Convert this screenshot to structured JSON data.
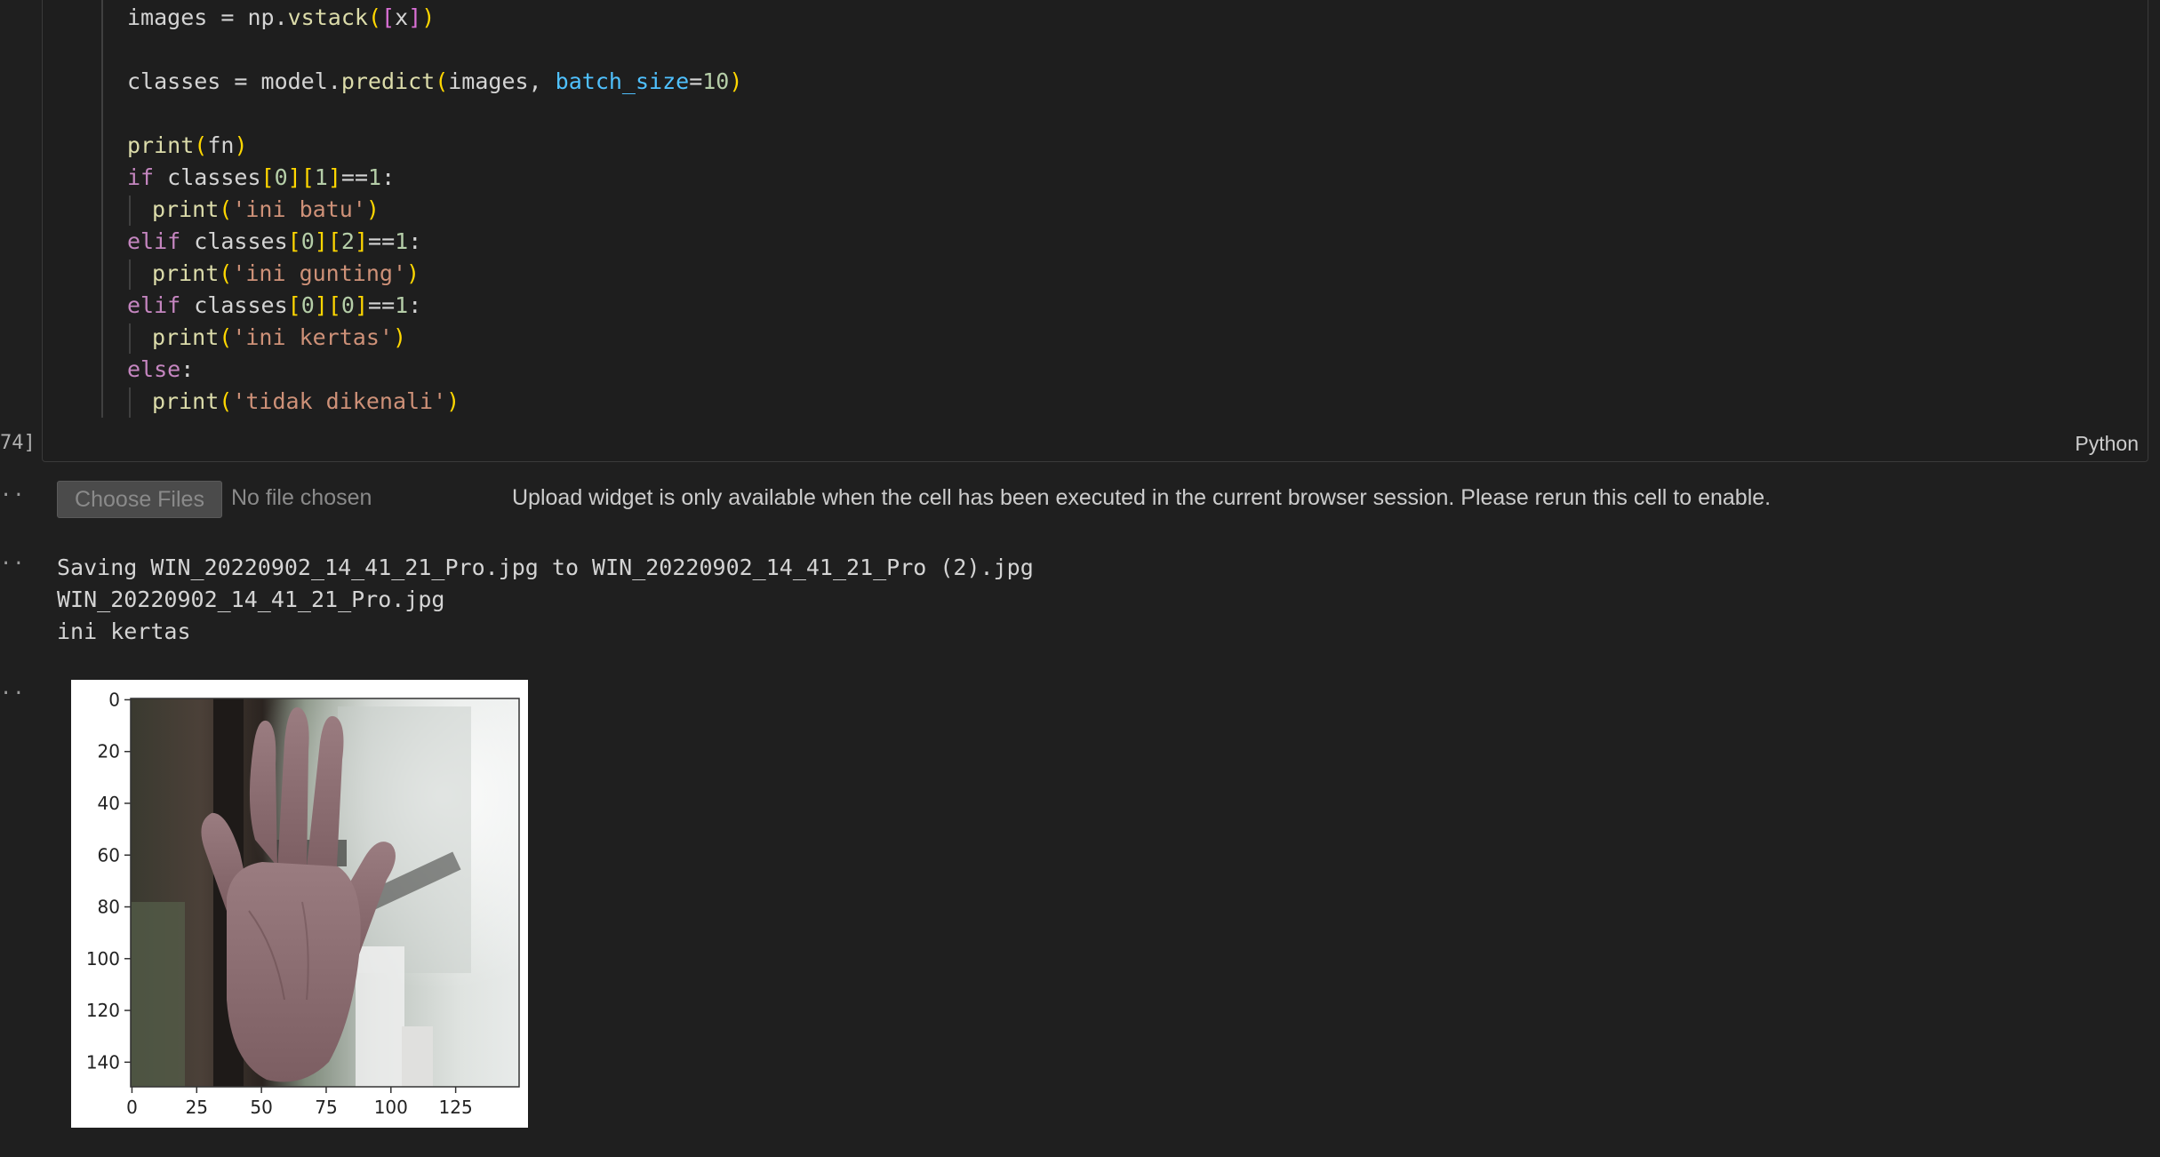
{
  "cell": {
    "code_lines": [
      {
        "indent": false,
        "tokens": [
          [
            "images = np.",
            ""
          ],
          [
            "vstack",
            "fn"
          ],
          [
            "(",
            "b1"
          ],
          [
            "[",
            "b2"
          ],
          [
            "x",
            ""
          ],
          [
            "]",
            "b2"
          ],
          [
            ")",
            "b1"
          ]
        ]
      },
      {
        "indent": false,
        "tokens": []
      },
      {
        "indent": false,
        "tokens": [
          [
            "classes = model.",
            ""
          ],
          [
            "predict",
            "fn"
          ],
          [
            "(",
            "b1"
          ],
          [
            "images, ",
            ""
          ],
          [
            "batch_size",
            "pa"
          ],
          [
            "=",
            ""
          ],
          [
            "10",
            "nu"
          ],
          [
            ")",
            "b1"
          ]
        ]
      },
      {
        "indent": false,
        "tokens": []
      },
      {
        "indent": false,
        "tokens": [
          [
            "print",
            "fn"
          ],
          [
            "(",
            "b1"
          ],
          [
            "fn",
            ""
          ],
          [
            ")",
            "b1"
          ]
        ]
      },
      {
        "indent": false,
        "tokens": [
          [
            "if",
            "kw"
          ],
          [
            " classes",
            ""
          ],
          [
            "[",
            "b1"
          ],
          [
            "0",
            "nu"
          ],
          [
            "]",
            "b1"
          ],
          [
            "[",
            "b1"
          ],
          [
            "1",
            "nu"
          ],
          [
            "]",
            "b1"
          ],
          [
            "==",
            ""
          ],
          [
            "1",
            "nu"
          ],
          [
            ":",
            ""
          ]
        ]
      },
      {
        "indent": true,
        "tokens": [
          [
            "print",
            "fn"
          ],
          [
            "(",
            "b1"
          ],
          [
            "'ini batu'",
            "st"
          ],
          [
            ")",
            "b1"
          ]
        ]
      },
      {
        "indent": false,
        "tokens": [
          [
            "elif",
            "kw"
          ],
          [
            " classes",
            ""
          ],
          [
            "[",
            "b1"
          ],
          [
            "0",
            "nu"
          ],
          [
            "]",
            "b1"
          ],
          [
            "[",
            "b1"
          ],
          [
            "2",
            "nu"
          ],
          [
            "]",
            "b1"
          ],
          [
            "==",
            ""
          ],
          [
            "1",
            "nu"
          ],
          [
            ":",
            ""
          ]
        ]
      },
      {
        "indent": true,
        "tokens": [
          [
            "print",
            "fn"
          ],
          [
            "(",
            "b1"
          ],
          [
            "'ini gunting'",
            "st"
          ],
          [
            ")",
            "b1"
          ]
        ]
      },
      {
        "indent": false,
        "tokens": [
          [
            "elif",
            "kw"
          ],
          [
            " classes",
            ""
          ],
          [
            "[",
            "b1"
          ],
          [
            "0",
            "nu"
          ],
          [
            "]",
            "b1"
          ],
          [
            "[",
            "b1"
          ],
          [
            "0",
            "nu"
          ],
          [
            "]",
            "b1"
          ],
          [
            "==",
            ""
          ],
          [
            "1",
            "nu"
          ],
          [
            ":",
            ""
          ]
        ]
      },
      {
        "indent": true,
        "tokens": [
          [
            "print",
            "fn"
          ],
          [
            "(",
            "b1"
          ],
          [
            "'ini kertas'",
            "st"
          ],
          [
            ")",
            "b1"
          ]
        ]
      },
      {
        "indent": false,
        "tokens": [
          [
            "else",
            "kw"
          ],
          [
            ":",
            ""
          ]
        ]
      },
      {
        "indent": true,
        "tokens": [
          [
            "print",
            "fn"
          ],
          [
            "(",
            "b1"
          ],
          [
            "'tidak dikenali'",
            "st"
          ],
          [
            ")",
            "b1"
          ]
        ]
      }
    ],
    "execution_count": "74]",
    "language": "Python"
  },
  "outputs": {
    "marker": "··",
    "upload": {
      "button_label": "Choose Files",
      "no_file_text": "No file chosen",
      "message": "Upload widget is only available when the cell has been executed in the current browser session. Please rerun this cell to enable."
    },
    "stdout": [
      "Saving WIN_20220902_14_41_21_Pro.jpg to WIN_20220902_14_41_21_Pro (2).jpg",
      "WIN_20220902_14_41_21_Pro.jpg",
      "ini kertas"
    ],
    "plot": {
      "y_ticks": [
        "0",
        "20",
        "40",
        "60",
        "80",
        "100",
        "120",
        "140"
      ],
      "x_ticks": [
        "0",
        "25",
        "50",
        "75",
        "100",
        "125"
      ],
      "y_range": [
        0,
        150
      ],
      "x_range": [
        0,
        150
      ]
    }
  },
  "colors": {
    "background": "#1f1f1f",
    "keyword": "#c586c0",
    "function": "#dcdcaa",
    "string": "#ce9178",
    "number": "#b5cea8",
    "parameter": "#4fc1ff"
  }
}
